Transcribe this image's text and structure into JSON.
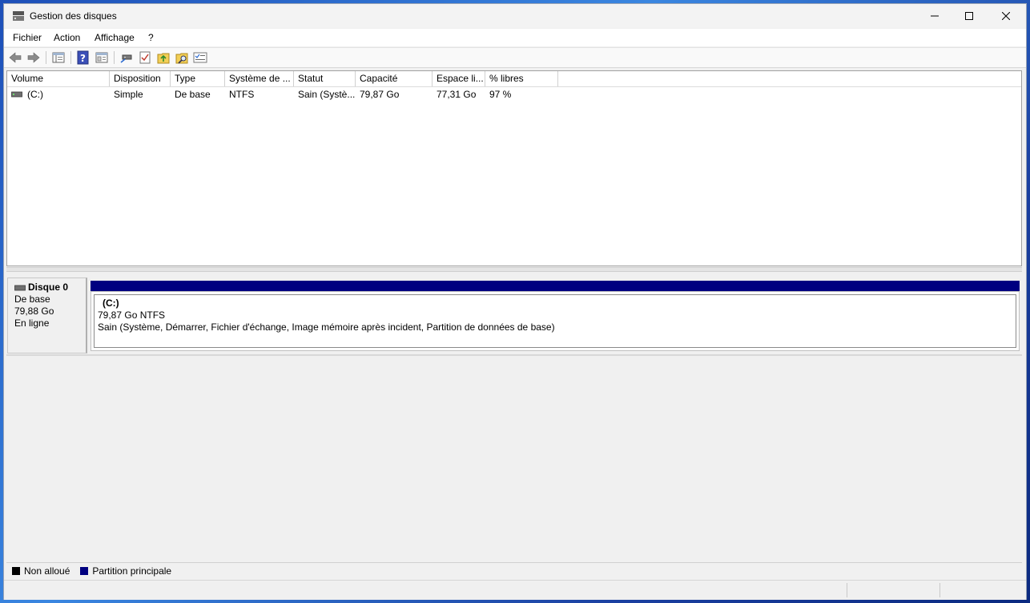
{
  "window": {
    "title": "Gestion des disques"
  },
  "menu": {
    "items": [
      "Fichier",
      "Action",
      "Affichage",
      "?"
    ]
  },
  "toolbar": {
    "icons": [
      "back-arrow-icon",
      "forward-arrow-icon",
      "console-tree-icon",
      "help-icon",
      "properties-icon",
      "disk-connect-icon",
      "checklist-icon",
      "folder-up-icon",
      "folder-search-icon",
      "settings-list-icon"
    ]
  },
  "volume_list": {
    "columns": [
      "Volume",
      "Disposition",
      "Type",
      "Système de ...",
      "Statut",
      "Capacité",
      "Espace li...",
      "% libres"
    ],
    "rows": [
      {
        "volume": "(C:)",
        "disposition": "Simple",
        "type": "De base",
        "filesystem": "NTFS",
        "status": "Sain (Systè...",
        "capacity": "79,87 Go",
        "free": "77,31 Go",
        "pct_free": "97 %"
      }
    ]
  },
  "disk": {
    "name": "Disque 0",
    "type": "De base",
    "size": "79,88 Go",
    "state": "En ligne",
    "partition": {
      "label": "(C:)",
      "size_fs": "79,87 Go NTFS",
      "status": "Sain (Système, Démarrer, Fichier d'échange, Image mémoire après incident, Partition de données de base)"
    }
  },
  "legend": {
    "unallocated": "Non alloué",
    "primary": "Partition principale",
    "unallocated_color": "#000000",
    "primary_color": "#000080"
  }
}
